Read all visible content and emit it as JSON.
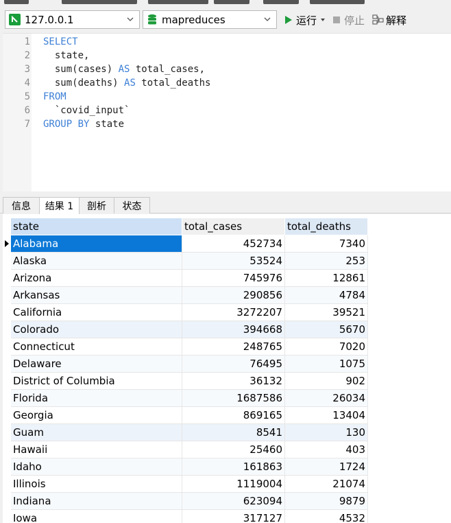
{
  "toolbar": {
    "connection": "127.0.0.1",
    "database": "mapreduces",
    "run_label": "运行",
    "stop_label": "停止",
    "explain_label": "解释"
  },
  "editor": {
    "lines": [
      {
        "num": "1",
        "parts": [
          {
            "t": "SELECT",
            "kw": true
          }
        ]
      },
      {
        "num": "2",
        "parts": [
          {
            "t": "  state,",
            "kw": false
          }
        ]
      },
      {
        "num": "3",
        "parts": [
          {
            "t": "  sum(cases) ",
            "kw": false
          },
          {
            "t": "AS",
            "kw": true
          },
          {
            "t": " total_cases,",
            "kw": false
          }
        ]
      },
      {
        "num": "4",
        "parts": [
          {
            "t": "  sum(deaths) ",
            "kw": false
          },
          {
            "t": "AS",
            "kw": true
          },
          {
            "t": " total_deaths",
            "kw": false
          }
        ]
      },
      {
        "num": "5",
        "parts": [
          {
            "t": "FROM",
            "kw": true
          }
        ]
      },
      {
        "num": "6",
        "parts": [
          {
            "t": "  `covid_input`",
            "kw": false
          }
        ]
      },
      {
        "num": "7",
        "parts": [
          {
            "t": "GROUP BY",
            "kw": true
          },
          {
            "t": " state",
            "kw": false
          }
        ]
      }
    ]
  },
  "tabs": [
    {
      "label": "信息",
      "active": false
    },
    {
      "label": "结果 1",
      "active": true
    },
    {
      "label": "剖析",
      "active": false
    },
    {
      "label": "状态",
      "active": false
    }
  ],
  "results": {
    "columns": [
      "state",
      "total_cases",
      "total_deaths"
    ],
    "rows": [
      [
        "Alabama",
        "452734",
        "7340"
      ],
      [
        "Alaska",
        "53524",
        "253"
      ],
      [
        "Arizona",
        "745976",
        "12861"
      ],
      [
        "Arkansas",
        "290856",
        "4784"
      ],
      [
        "California",
        "3272207",
        "39521"
      ],
      [
        "Colorado",
        "394668",
        "5670"
      ],
      [
        "Connecticut",
        "248765",
        "7020"
      ],
      [
        "Delaware",
        "76495",
        "1075"
      ],
      [
        "District of Columbia",
        "36132",
        "902"
      ],
      [
        "Florida",
        "1687586",
        "26034"
      ],
      [
        "Georgia",
        "869165",
        "13404"
      ],
      [
        "Guam",
        "8541",
        "130"
      ],
      [
        "Hawaii",
        "25460",
        "403"
      ],
      [
        "Idaho",
        "161863",
        "1724"
      ],
      [
        "Illinois",
        "1119004",
        "21074"
      ],
      [
        "Indiana",
        "623094",
        "9879"
      ],
      [
        "Iowa",
        "317127",
        "4532"
      ]
    ],
    "selected_row": 0
  },
  "colors": {
    "keyword": "#3c7fd6",
    "selection": "#0b78d7",
    "header": "#dde8f5",
    "header_active": "#cde0f5",
    "run_green": "#1f9c3c"
  }
}
